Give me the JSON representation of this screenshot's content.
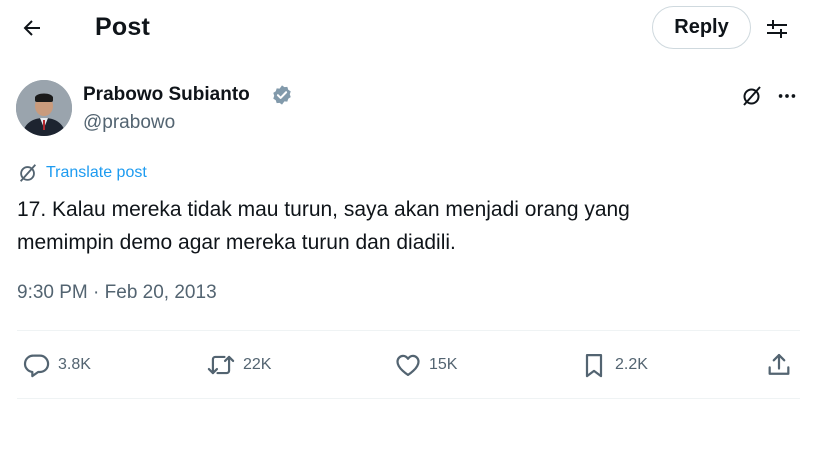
{
  "header": {
    "title": "Post",
    "reply_label": "Reply"
  },
  "post": {
    "author_name": "Prabowo Subianto",
    "handle": "@prabowo",
    "translate_label": "Translate post",
    "text_line1": "17. Kalau mereka tidak mau turun, saya akan menjadi orang yang",
    "text_line2": "memimpin demo agar mereka turun dan diadili.",
    "time": "9:30 PM",
    "separator": "·",
    "date": "Feb 20, 2013"
  },
  "stats": {
    "replies": "3.8K",
    "reposts": "22K",
    "likes": "15K",
    "bookmarks": "2.2K"
  },
  "icons": {
    "back": "arrow-left-icon",
    "settings": "sliders-icon",
    "verified": "verified-badge-icon",
    "grok": "grok-icon",
    "more": "more-horizontal-icon",
    "translate": "translate-icon",
    "reply": "reply-icon",
    "repost": "repost-icon",
    "like": "heart-icon",
    "bookmark": "bookmark-icon",
    "share": "share-icon"
  },
  "colors": {
    "text": "#0f1419",
    "secondary": "#536471",
    "accent": "#1d9bf0",
    "border": "#cfd9de"
  }
}
